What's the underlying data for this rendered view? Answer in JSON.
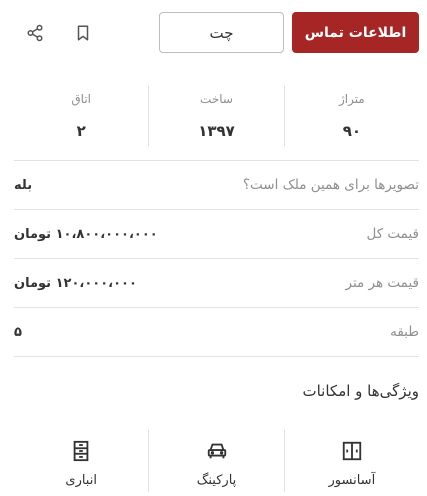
{
  "header": {
    "contact_label": "اطلاعات تماس",
    "chat_label": "چت",
    "icons": [
      "bookmark-icon",
      "share-icon"
    ]
  },
  "stats": [
    {
      "label": "متراژ",
      "value": "۹۰"
    },
    {
      "label": "ساخت",
      "value": "۱۳۹۷"
    },
    {
      "label": "اتاق",
      "value": "۲"
    }
  ],
  "details": [
    {
      "label": "تصویرها برای همین ملک است؟",
      "value": "بله"
    },
    {
      "label": "قیمت کل",
      "value": "۱۰،۸۰۰،۰۰۰،۰۰۰ تومان"
    },
    {
      "label": "قیمت هر متر",
      "value": "۱۲۰،۰۰۰،۰۰۰ تومان"
    },
    {
      "label": "طبقه",
      "value": "۵"
    }
  ],
  "features": {
    "title": "ویژگی‌ها و امکانات",
    "items": [
      {
        "label": "آسانسور",
        "icon": "elevator-icon"
      },
      {
        "label": "پارکینگ",
        "icon": "car-icon"
      },
      {
        "label": "انباری",
        "icon": "storage-icon"
      }
    ]
  },
  "colors": {
    "accent": "#a62626",
    "muted": "#8f8f8f",
    "divider": "#e2e2e2"
  }
}
